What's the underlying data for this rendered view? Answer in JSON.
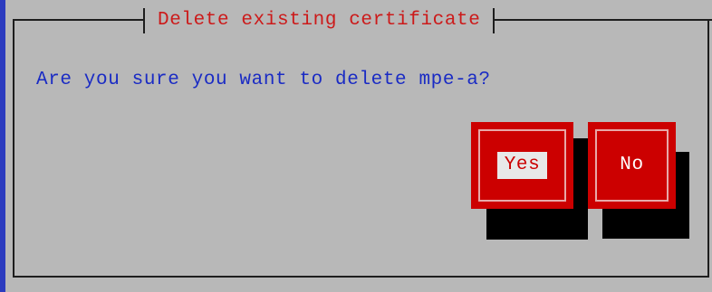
{
  "dialog": {
    "title": "Delete existing certificate",
    "message": "Are you sure you want to delete mpe-a?"
  },
  "buttons": {
    "yes_label": "Yes",
    "no_label": "No",
    "focused": "Yes"
  },
  "colors": {
    "dialog_bg": "#b8b8b8",
    "title_text": "#cc1a1a",
    "message_text": "#1a2bc4",
    "button_bg": "#cc0000",
    "button_shadow": "#000000",
    "screen_strip": "#2b3bbf"
  }
}
